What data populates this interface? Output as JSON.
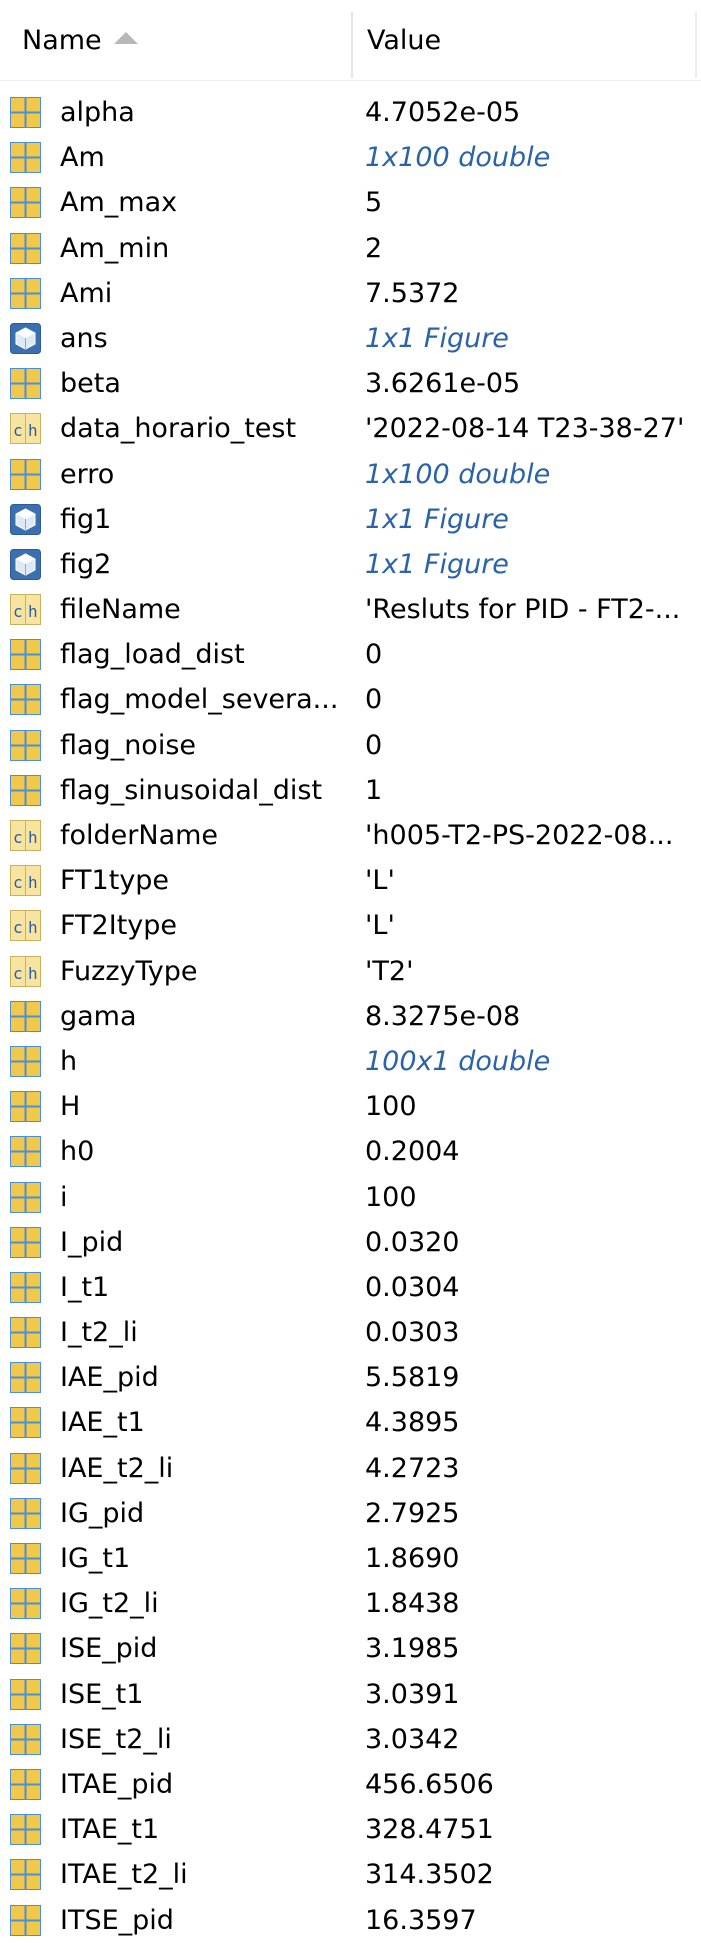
{
  "header": {
    "name_label": "Name",
    "value_label": "Value",
    "sort_icon": "sort-ascending-icon"
  },
  "colors": {
    "matrix_icon": "#f2c84b",
    "matrix_icon_grid": "#4a90d9",
    "link_value": "#2a63a8",
    "divider": "#e4e4e4"
  },
  "variables": [
    {
      "name": "alpha",
      "value": "4.7052e-05",
      "icon": "matrix-icon",
      "italic": false
    },
    {
      "name": "Am",
      "value": "1x100 double",
      "icon": "matrix-icon",
      "italic": true
    },
    {
      "name": "Am_max",
      "value": "5",
      "icon": "matrix-icon",
      "italic": false
    },
    {
      "name": "Am_min",
      "value": "2",
      "icon": "matrix-icon",
      "italic": false
    },
    {
      "name": "Ami",
      "value": "7.5372",
      "icon": "matrix-icon",
      "italic": false
    },
    {
      "name": "ans",
      "value": "1x1 Figure",
      "icon": "object-icon",
      "italic": true
    },
    {
      "name": "beta",
      "value": "3.6261e-05",
      "icon": "matrix-icon",
      "italic": false
    },
    {
      "name": "data_horario_test",
      "value": "'2022-08-14 T23-38-27'",
      "icon": "char-icon",
      "italic": false
    },
    {
      "name": "erro",
      "value": "1x100 double",
      "icon": "matrix-icon",
      "italic": true
    },
    {
      "name": "fig1",
      "value": "1x1 Figure",
      "icon": "object-icon",
      "italic": true
    },
    {
      "name": "fig2",
      "value": "1x1 Figure",
      "icon": "object-icon",
      "italic": true
    },
    {
      "name": "fileName",
      "value": "'Resluts for PID - FT2-...",
      "icon": "char-icon",
      "italic": false
    },
    {
      "name": "flag_load_dist",
      "value": "0",
      "icon": "matrix-icon",
      "italic": false
    },
    {
      "name": "flag_model_severa...",
      "value": "0",
      "icon": "matrix-icon",
      "italic": false
    },
    {
      "name": "flag_noise",
      "value": "0",
      "icon": "matrix-icon",
      "italic": false
    },
    {
      "name": "flag_sinusoidal_dist",
      "value": "1",
      "icon": "matrix-icon",
      "italic": false
    },
    {
      "name": "folderName",
      "value": "'h005-T2-PS-2022-08...",
      "icon": "char-icon",
      "italic": false
    },
    {
      "name": "FT1type",
      "value": "'L'",
      "icon": "char-icon",
      "italic": false
    },
    {
      "name": "FT2Itype",
      "value": "'L'",
      "icon": "char-icon",
      "italic": false
    },
    {
      "name": "FuzzyType",
      "value": "'T2'",
      "icon": "char-icon",
      "italic": false
    },
    {
      "name": "gama",
      "value": "8.3275e-08",
      "icon": "matrix-icon",
      "italic": false
    },
    {
      "name": "h",
      "value": "100x1 double",
      "icon": "matrix-icon",
      "italic": true
    },
    {
      "name": "H",
      "value": "100",
      "icon": "matrix-icon",
      "italic": false
    },
    {
      "name": "h0",
      "value": "0.2004",
      "icon": "matrix-icon",
      "italic": false
    },
    {
      "name": "i",
      "value": "100",
      "icon": "matrix-icon",
      "italic": false
    },
    {
      "name": "I_pid",
      "value": "0.0320",
      "icon": "matrix-icon",
      "italic": false
    },
    {
      "name": "I_t1",
      "value": "0.0304",
      "icon": "matrix-icon",
      "italic": false
    },
    {
      "name": "I_t2_li",
      "value": "0.0303",
      "icon": "matrix-icon",
      "italic": false
    },
    {
      "name": "IAE_pid",
      "value": "5.5819",
      "icon": "matrix-icon",
      "italic": false
    },
    {
      "name": "IAE_t1",
      "value": "4.3895",
      "icon": "matrix-icon",
      "italic": false
    },
    {
      "name": "IAE_t2_li",
      "value": "4.2723",
      "icon": "matrix-icon",
      "italic": false
    },
    {
      "name": "IG_pid",
      "value": "2.7925",
      "icon": "matrix-icon",
      "italic": false
    },
    {
      "name": "IG_t1",
      "value": "1.8690",
      "icon": "matrix-icon",
      "italic": false
    },
    {
      "name": "IG_t2_li",
      "value": "1.8438",
      "icon": "matrix-icon",
      "italic": false
    },
    {
      "name": "ISE_pid",
      "value": "3.1985",
      "icon": "matrix-icon",
      "italic": false
    },
    {
      "name": "ISE_t1",
      "value": "3.0391",
      "icon": "matrix-icon",
      "italic": false
    },
    {
      "name": "ISE_t2_li",
      "value": "3.0342",
      "icon": "matrix-icon",
      "italic": false
    },
    {
      "name": "ITAE_pid",
      "value": "456.6506",
      "icon": "matrix-icon",
      "italic": false
    },
    {
      "name": "ITAE_t1",
      "value": "328.4751",
      "icon": "matrix-icon",
      "italic": false
    },
    {
      "name": "ITAE_t2_li",
      "value": "314.3502",
      "icon": "matrix-icon",
      "italic": false
    },
    {
      "name": "ITSE_pid",
      "value": "16.3597",
      "icon": "matrix-icon",
      "italic": false
    }
  ]
}
